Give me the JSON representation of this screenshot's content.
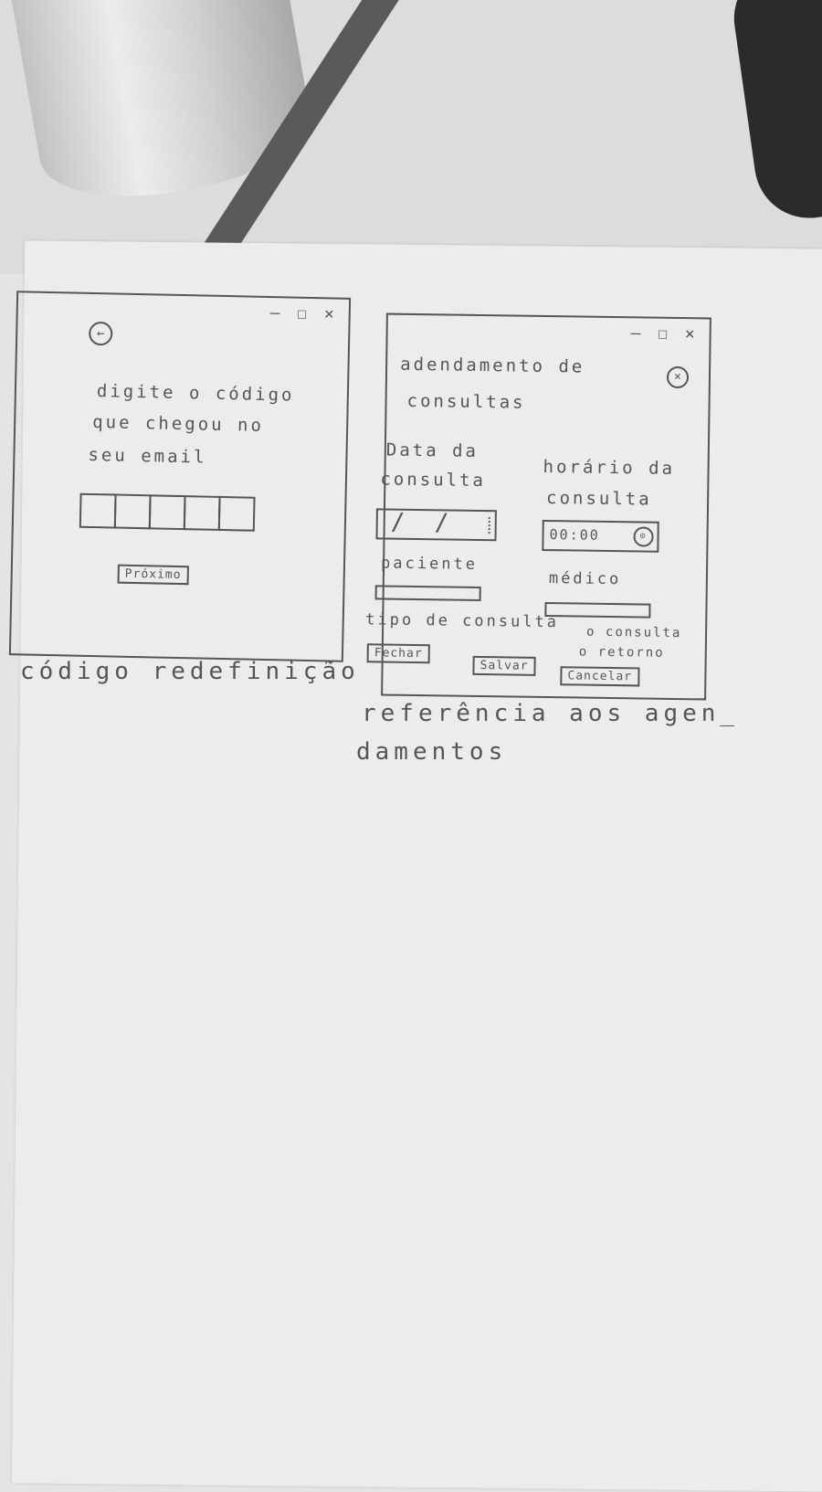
{
  "sketch1": {
    "window_controls": "— ☐ ×",
    "back_icon": "←",
    "instruction_lines": [
      "digite o código",
      "que chegou no",
      "seu email"
    ],
    "code_box_count": 5,
    "next_button": "Próximo",
    "caption": "código redefinição"
  },
  "sketch2": {
    "window_controls": "— ☐ ×",
    "title_lines": [
      "adendamento de",
      "consultas"
    ],
    "close_icon": "×",
    "date_label": [
      "Data da",
      "consulta"
    ],
    "time_label": [
      "horário da",
      "consulta"
    ],
    "time_value": "00:00",
    "patient_label": "paciente",
    "doctor_label": "médico",
    "type_label": "tipo de consulta",
    "type_options": [
      "o consulta",
      "o retorno"
    ],
    "buttons": {
      "mark": "Fechar",
      "save": "Salvar",
      "cancel": "Cancelar"
    },
    "caption_lines": [
      "referência aos agen_",
      "damentos"
    ]
  },
  "colors": {
    "pencil": "#555555",
    "paper": "#ececea"
  }
}
